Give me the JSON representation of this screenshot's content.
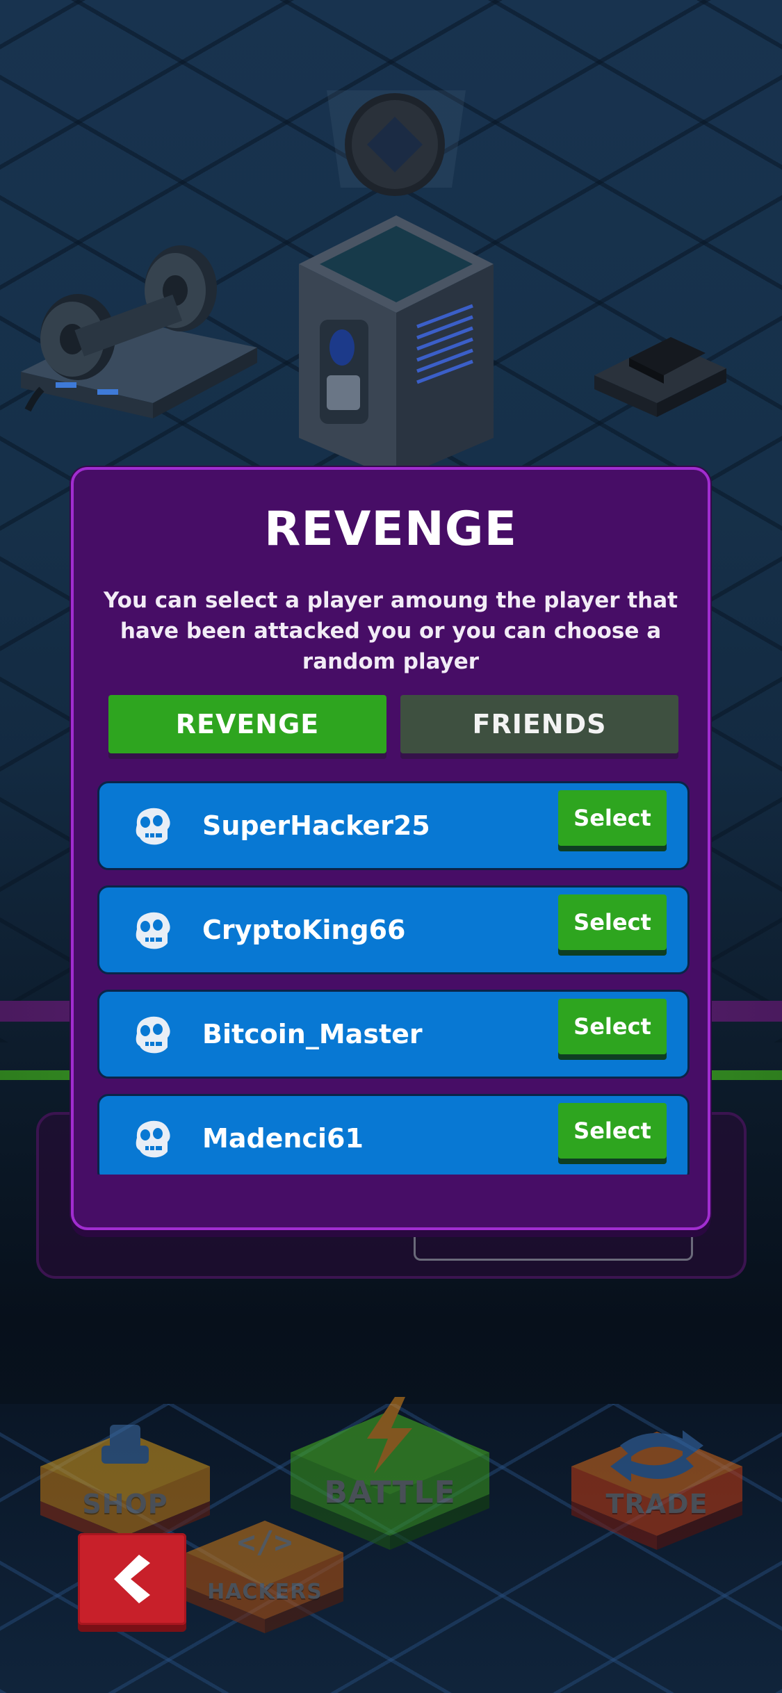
{
  "modal": {
    "title": "REVENGE",
    "description": "You can select a player amoung the player that have been attacked you or you can choose a random player",
    "tabs": [
      {
        "label": "REVENGE",
        "active": true
      },
      {
        "label": "FRIENDS",
        "active": false
      }
    ],
    "players": [
      {
        "name": "SuperHacker25",
        "action": "Select",
        "avatar_icon": "ape-skull-icon"
      },
      {
        "name": "CryptoKing66",
        "action": "Select",
        "avatar_icon": "ape-skull-icon"
      },
      {
        "name": "Bitcoin_Master",
        "action": "Select",
        "avatar_icon": "ape-skull-icon"
      },
      {
        "name": "Madenci61",
        "action": "Select",
        "avatar_icon": "ape-skull-icon"
      }
    ]
  },
  "nav": {
    "shop": "SHOP",
    "battle": "BATTLE",
    "trade": "TRADE",
    "hackers": "HACKERS",
    "back_icon": "chevron-left-icon"
  },
  "colors": {
    "modal_bg": "#470d66",
    "modal_border": "#a12dd0",
    "tab_active": "#2ea51f",
    "tab_inactive": "#3e5040",
    "row_bg": "#0878d3",
    "back_button": "#c8202a"
  }
}
